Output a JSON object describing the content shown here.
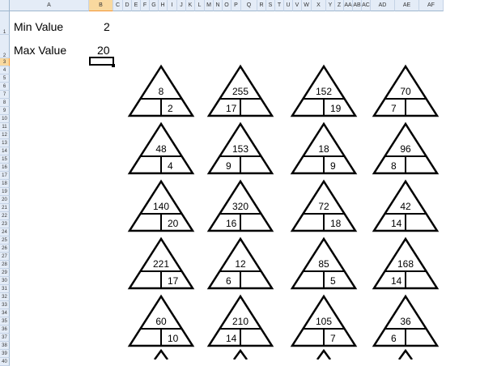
{
  "columns": [
    "A",
    "B",
    "C",
    "D",
    "E",
    "F",
    "G",
    "H",
    "I",
    "J",
    "K",
    "L",
    "M",
    "N",
    "O",
    "P",
    "Q",
    "R",
    "S",
    "T",
    "U",
    "V",
    "W",
    "X",
    "Y",
    "Z",
    "AA",
    "AB",
    "AC",
    "AD",
    "AE",
    "AF"
  ],
  "selected_column": "B",
  "rows": [
    "1",
    "2",
    "3",
    "4",
    "5",
    "6",
    "7",
    "8",
    "9",
    "10",
    "11",
    "12",
    "13",
    "14",
    "15",
    "16",
    "17",
    "18",
    "19",
    "20",
    "21",
    "22",
    "23",
    "24",
    "25",
    "26",
    "27",
    "28",
    "29",
    "30",
    "31",
    "32",
    "33",
    "34",
    "35",
    "36",
    "37",
    "38",
    "39",
    "40"
  ],
  "selected_row": "3",
  "cells": {
    "a1": "Min Value",
    "b1": "2",
    "a2": "Max Value",
    "b2": "20"
  },
  "triangles": [
    [
      "8",
      "",
      "2"
    ],
    [
      "255",
      "17",
      ""
    ],
    [
      "152",
      "",
      "19"
    ],
    [
      "70",
      "7",
      ""
    ],
    [
      "48",
      "",
      "4"
    ],
    [
      "153",
      "9",
      ""
    ],
    [
      "18",
      "",
      "9"
    ],
    [
      "96",
      "8",
      ""
    ],
    [
      "140",
      "",
      "20"
    ],
    [
      "320",
      "16",
      ""
    ],
    [
      "72",
      "",
      "18"
    ],
    [
      "42",
      "14",
      ""
    ],
    [
      "221",
      "",
      "17"
    ],
    [
      "12",
      "6",
      ""
    ],
    [
      "85",
      "",
      "5"
    ],
    [
      "168",
      "14",
      ""
    ],
    [
      "60",
      "",
      "10"
    ],
    [
      "210",
      "14",
      ""
    ],
    [
      "105",
      "",
      "7"
    ],
    [
      "36",
      "6",
      ""
    ]
  ]
}
